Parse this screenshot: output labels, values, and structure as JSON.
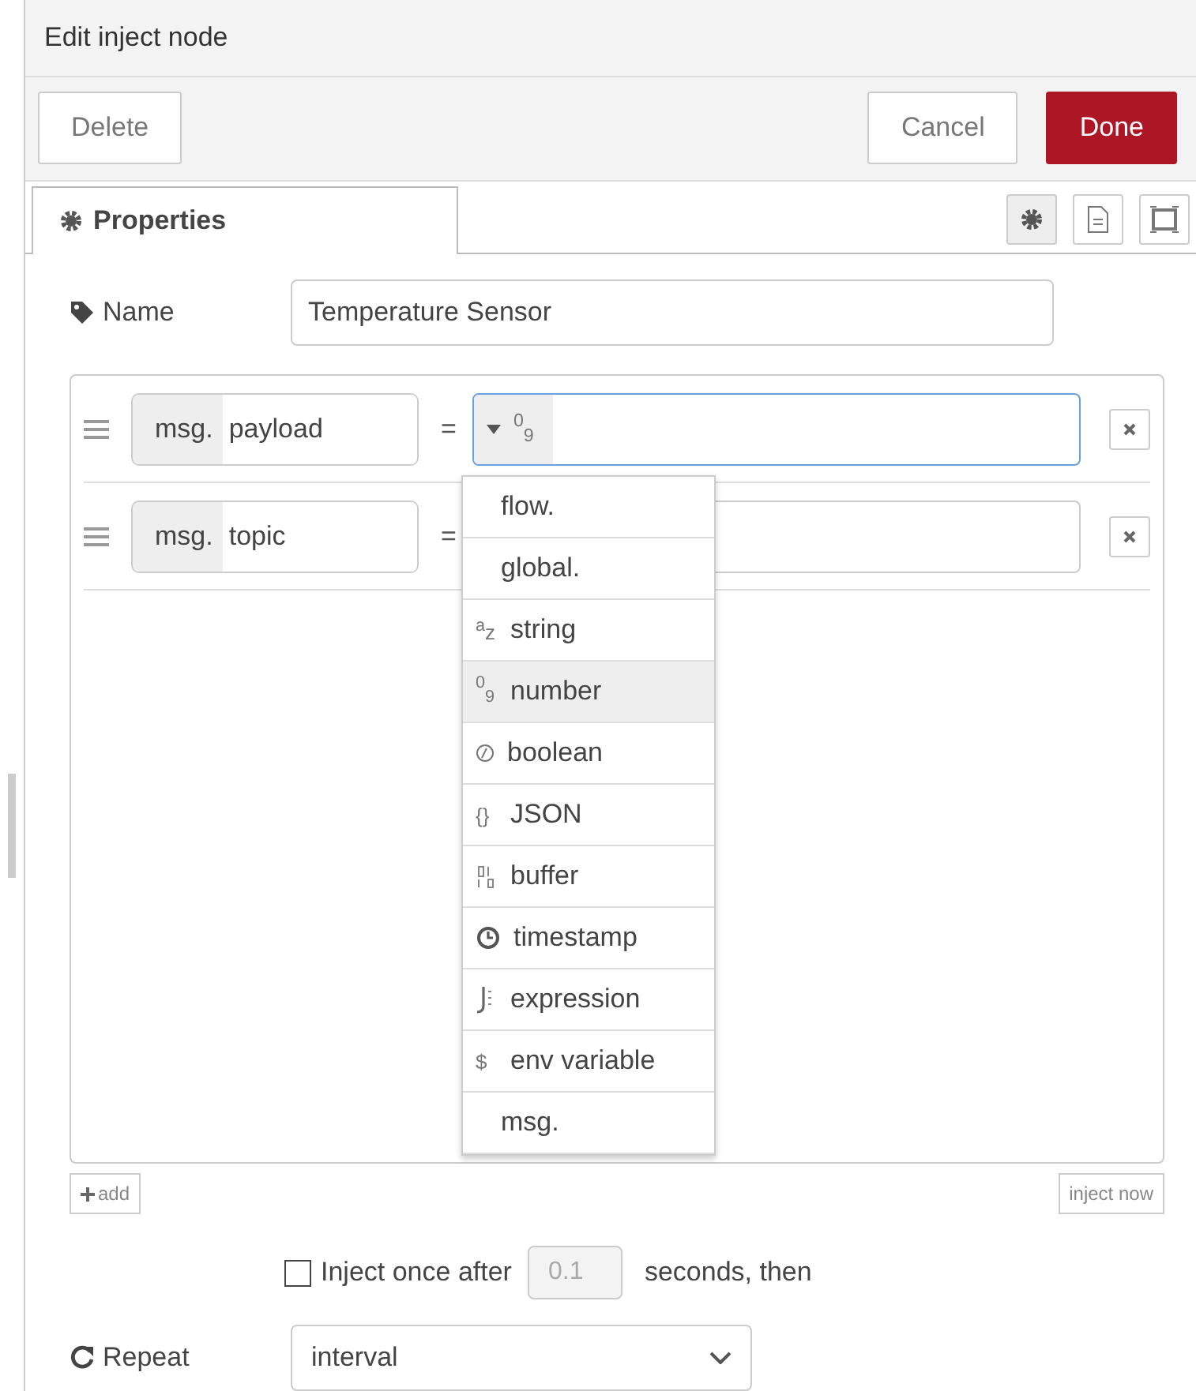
{
  "window": {
    "title": "Edit inject node"
  },
  "toolbar": {
    "buttons": [
      {
        "label": "Delete",
        "kind": "plain"
      },
      {
        "label": "Cancel",
        "kind": "plain"
      },
      {
        "label": "Done",
        "kind": "primary"
      }
    ]
  },
  "tabs": [
    {
      "label": "Properties",
      "selected": true
    }
  ],
  "tab_icons": [
    {
      "kind": "gear",
      "selected": true
    },
    {
      "kind": "doc",
      "selected": false
    },
    {
      "kind": "frame",
      "selected": false
    }
  ],
  "name_field": {
    "label": "Name",
    "value": "Temperature Sensor"
  },
  "properties": [
    {
      "prefix": "msg.",
      "key": "payload",
      "equals": "=",
      "type_glyph": "$^{0}$$_{9}$",
      "focused": true
    },
    {
      "prefix": "msg.",
      "key": "topic",
      "equals": "=",
      "focused": false
    }
  ],
  "type_menu": [
    {
      "label": "flow.",
      "kind": "plain",
      "selected": false
    },
    {
      "label": "global.",
      "kind": "plain",
      "selected": false
    },
    {
      "label": "string",
      "kind": "glyph",
      "glyph": "$^{a}$z",
      "selected": false
    },
    {
      "label": "number",
      "kind": "glyph",
      "glyph": "$^{0}$$_{9}$",
      "selected": true
    },
    {
      "label": "boolean",
      "kind": "boolean",
      "selected": false
    },
    {
      "label": "JSON",
      "kind": "glyph",
      "glyph": "{}",
      "selected": false
    },
    {
      "label": "buffer",
      "kind": "binary",
      "selected": false
    },
    {
      "label": "timestamp",
      "kind": "clock",
      "selected": false
    },
    {
      "label": "expression",
      "kind": "expression",
      "selected": false
    },
    {
      "label": "env variable",
      "kind": "glyph",
      "glyph": "$",
      "selected": false
    },
    {
      "label": "msg.",
      "kind": "plain",
      "selected": false
    }
  ],
  "add_button": "add",
  "inject_now_button": "inject now",
  "inject_once": {
    "checked": false,
    "label": "Inject once after",
    "placeholder": "0.1",
    "suffix": "seconds, then"
  },
  "repeat": {
    "label": "Repeat",
    "value": "interval"
  }
}
